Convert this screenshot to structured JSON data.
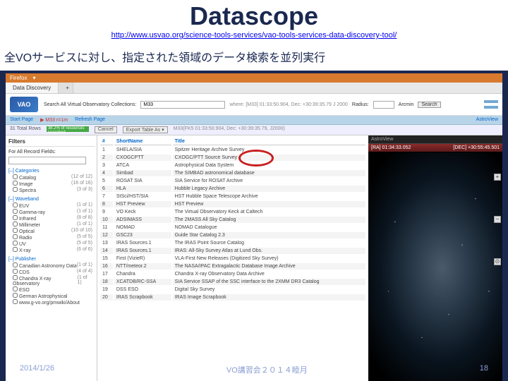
{
  "title": "Datascope",
  "url": "http://www.usvao.org/science-tools-services/vao-tools-services-data-discovery-tool/",
  "subtitle": "全VOサービスに対し、指定された領域のデータ検索を並列実行",
  "browser": {
    "name": "Firefox"
  },
  "tabs": {
    "main": "Data Discovery"
  },
  "searchbar": {
    "label": "Search All Virtual Observatory Collections:",
    "where": "M33",
    "whereResolved": "where: [M33] 01:33:50.904, Dec: +30:39:35.79 J 2000",
    "radiusLabel": "Radius:",
    "radius": "",
    "unit": "Arcmin",
    "searchBtn": "Search"
  },
  "toolbar": {
    "start": "Start Page",
    "query": "M33 r=1m",
    "refresh": "Refresh Page"
  },
  "status": {
    "total": "31 Total Rows",
    "progress": "38.2% of resources searched",
    "cancel": "Cancel",
    "export": "Export Table As ▾",
    "loc": "M33(FK5 01:33:50.904, Dec: +30:39:35.79, J2000)"
  },
  "filters": {
    "header": "Filters",
    "recordHeader": "For All Record Fields:",
    "cat": {
      "title": "[–] Categories",
      "items": [
        {
          "n": "Catalog",
          "c": "(12 of 12)"
        },
        {
          "n": "Image",
          "c": "(16 of 16)"
        },
        {
          "n": "Spectra",
          "c": "(3 of 3)"
        }
      ]
    },
    "wav": {
      "title": "[–] Waveband",
      "items": [
        {
          "n": "EUV",
          "c": "(1 of 1)"
        },
        {
          "n": "Gamma-ray",
          "c": "(1 of 1)"
        },
        {
          "n": "Infrared",
          "c": "(8 of 8)"
        },
        {
          "n": "Millimeter",
          "c": "(1 of 1)"
        },
        {
          "n": "Optical",
          "c": "(10 of 10)"
        },
        {
          "n": "Radio",
          "c": "(5 of 5)"
        },
        {
          "n": "UV",
          "c": "(5 of 5)"
        },
        {
          "n": "X-ray",
          "c": "(6 of 6)"
        }
      ]
    },
    "pub": {
      "title": "[–] Publisher",
      "items": [
        {
          "n": "Canadian Astronomy Data",
          "c": "(1 of 1)"
        },
        {
          "n": "CDS",
          "c": "(4 of 4)"
        },
        {
          "n": "Chandra X-ray Observatory",
          "c": "(1 of 1)"
        },
        {
          "n": "ESO",
          "c": ""
        },
        {
          "n": "German Astrophysical",
          "c": ""
        },
        {
          "n": "www.g-vo.org/pmwiki/About",
          "c": ""
        }
      ]
    }
  },
  "table": {
    "cols": {
      "n": "#",
      "name": "ShortName",
      "title": "Title"
    },
    "rows": [
      {
        "n": "1",
        "name": "SHELA/SIA",
        "title": "Spitzer Heritage Archive Survey"
      },
      {
        "n": "2",
        "name": "CXOGCPTT",
        "title": "CXOGC/PTT Source Survey"
      },
      {
        "n": "3",
        "name": "ATCA",
        "title": "Astrophysical Data System"
      },
      {
        "n": "4",
        "name": "Simbad",
        "title": "The SIMBAD astronomical database"
      },
      {
        "n": "5",
        "name": "ROSAT SIA",
        "title": "SIA Service for ROSAT Archive"
      },
      {
        "n": "6",
        "name": "HLA",
        "title": "Hubble Legacy Archive"
      },
      {
        "n": "7",
        "name": "StSci/HST/SIA",
        "title": "HST Hubble Space Telescope Archive"
      },
      {
        "n": "8",
        "name": "HST Preview",
        "title": "HST Preview"
      },
      {
        "n": "9",
        "name": "VO Keck",
        "title": "The Virtual Observatory Keck at Caltech"
      },
      {
        "n": "10",
        "name": "ADSIMASS",
        "title": "The 2MASS All Sky Catalog"
      },
      {
        "n": "11",
        "name": "NOMAD",
        "title": "NOMAD Catalogue"
      },
      {
        "n": "12",
        "name": "GSC23",
        "title": "Guide Star Catalog 2.3"
      },
      {
        "n": "13",
        "name": "IRAS Sources.1",
        "title": "The IRAS Point Source Catalog"
      },
      {
        "n": "14",
        "name": "IRAS Sources.1",
        "title": "IRAS: All-Sky Survey Atlas at Lund Obs."
      },
      {
        "n": "15",
        "name": "First (VizieR)",
        "title": "VLA-First New Releases (Digitized Sky Survey)"
      },
      {
        "n": "16",
        "name": "NTT/meteor.2",
        "title": "The NASA/IPAC Extragalactic Database Image Archive"
      },
      {
        "n": "17",
        "name": "Chandra",
        "title": "Chandra X-ray Observatory Data Archive"
      },
      {
        "n": "18",
        "name": "XCATDB/RC-SSA",
        "title": "SIA Service SSAP of the SSC interface to the 2XMM DR3 Catalog"
      },
      {
        "n": "19",
        "name": "DSS ESO",
        "title": "Digital Sky Survey"
      },
      {
        "n": "20",
        "name": "IRAS Scrapbook",
        "title": "IRAS Image Scrapbook"
      }
    ]
  },
  "astroview": {
    "title": "AstroView",
    "ra": "[RA] 01:34:33.052",
    "dec": "[DEC] +30:55:45.501"
  },
  "footer": {
    "date": "2014/1/26",
    "center": "VO講習会２０１４睦月",
    "page": "18"
  }
}
